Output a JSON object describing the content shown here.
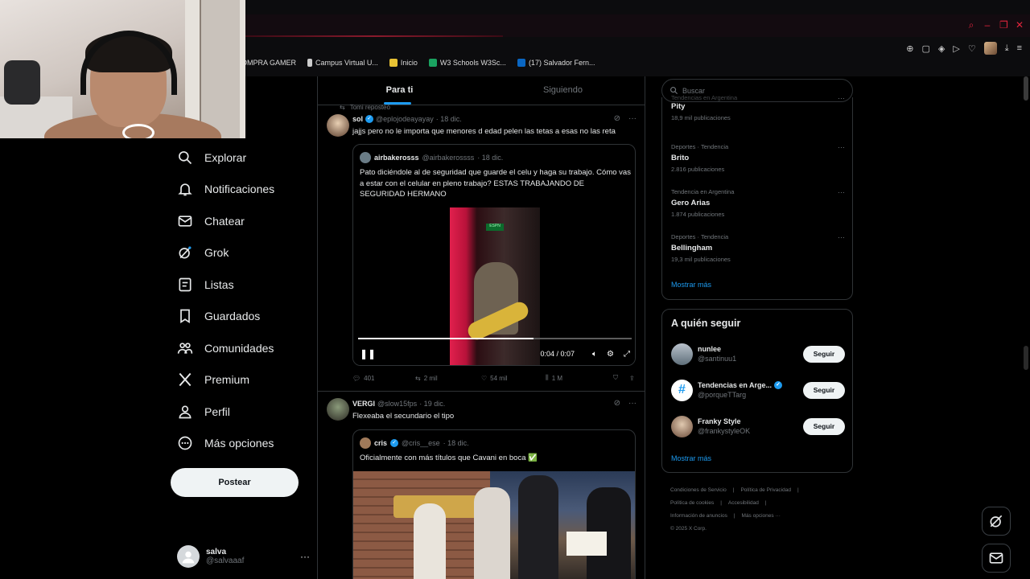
{
  "browser": {
    "bookmarks": [
      {
        "label": "OMPRA GAMER"
      },
      {
        "label": "Campus Virtual U..."
      },
      {
        "label": "Inicio"
      },
      {
        "label": "W3 Schools W3Sc..."
      },
      {
        "label": "(17) Salvador Fern..."
      }
    ],
    "colors": {
      "accent": "#e0243c"
    }
  },
  "nav": {
    "items": [
      {
        "label": "Explorar",
        "icon": "search-icon"
      },
      {
        "label": "Notificaciones",
        "icon": "bell-icon"
      },
      {
        "label": "Chatear",
        "icon": "mail-icon"
      },
      {
        "label": "Grok",
        "icon": "grok-icon"
      },
      {
        "label": "Listas",
        "icon": "list-icon"
      },
      {
        "label": "Guardados",
        "icon": "bookmark-icon"
      },
      {
        "label": "Comunidades",
        "icon": "people-icon"
      },
      {
        "label": "Premium",
        "icon": "x-logo-icon"
      },
      {
        "label": "Perfil",
        "icon": "person-icon"
      },
      {
        "label": "Más opciones",
        "icon": "more-circle-icon"
      }
    ],
    "post_label": "Postear",
    "user": {
      "name": "salva",
      "handle": "@salvaaaf",
      "more": "···"
    }
  },
  "feed": {
    "tabs": [
      {
        "label": "Para ti"
      },
      {
        "label": "Siguiendo"
      }
    ],
    "repost_note": "Tomi reposteó",
    "tweets": [
      {
        "name": "sol",
        "handle": "@eplojodeayayay",
        "date": "· 18 dic.",
        "text": "jajjs pero no le importa que menores d edad pelen las tetas a esas no las reta",
        "quote": {
          "name": "airbakerosss",
          "handle": "@airbakerossss",
          "date": "· 18 dic.",
          "text": "Pato diciéndole al de seguridad que guarde el celu y haga su trabajo. Cómo vas a estar con el celular en pleno trabajo? ESTAS TRABAJANDO DE SEGURIDAD HERMANO",
          "video": {
            "time": "0:04 / 0:07",
            "progress": 0.64,
            "sign": "ESPN"
          }
        },
        "stats": {
          "replies": "401",
          "reposts": "2 mil",
          "likes": "54 mil",
          "views": "1 M"
        }
      },
      {
        "name": "VERGI",
        "handle": "@slow15fps",
        "date": "· 19 dic.",
        "text": "Flexeaba el secundario el tipo",
        "quote": {
          "name": "cris",
          "handle": "@cris__ese",
          "date": "· 18 dic.",
          "text": "Oficialmente con más títulos que Cavani en boca ✅"
        }
      }
    ]
  },
  "sidebar": {
    "search_placeholder": "Buscar",
    "trends_partial_context": "Tendencias en Argentina",
    "trends": [
      {
        "context": "",
        "title": "Pity",
        "count": "18,9 mil publicaciones"
      },
      {
        "context": "Deportes · Tendencia",
        "title": "Brito",
        "count": "2.816 publicaciones"
      },
      {
        "context": "Tendencia en Argentina",
        "title": "Gero Arias",
        "count": "1.874 publicaciones"
      },
      {
        "context": "Deportes · Tendencia",
        "title": "Bellingham",
        "count": "19,3 mil publicaciones"
      }
    ],
    "show_more": "Mostrar más",
    "who_to_follow": {
      "title": "A quién seguir",
      "accounts": [
        {
          "name": "nunlee",
          "handle": "@santinuu1",
          "button": "Seguir"
        },
        {
          "name": "Tendencias en Arge...",
          "handle": "@porqueTTarg",
          "button": "Seguir"
        },
        {
          "name": "Franky Style",
          "handle": "@frankystyleOK",
          "button": "Seguir"
        }
      ],
      "show_more": "Mostrar más"
    },
    "footer": {
      "links": [
        "Condiciones de Servicio",
        "Política de Privacidad",
        "Política de cookies",
        "Accesibilidad",
        "Información de anuncios",
        "Más opciones ···"
      ],
      "copyright": "© 2025 X Corp."
    }
  }
}
